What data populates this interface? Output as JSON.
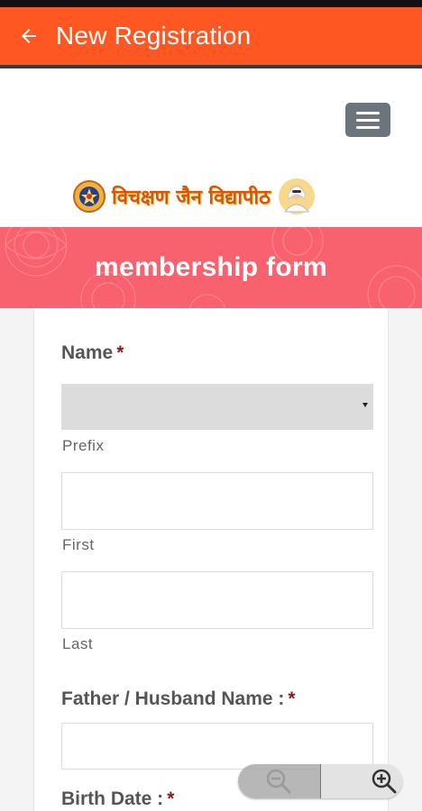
{
  "app_bar": {
    "title": "New Registration",
    "back_icon": "arrow-left-icon",
    "background": "#ff5722"
  },
  "nav": {
    "menu_icon": "hamburger-menu-icon"
  },
  "logo": {
    "text": "विचक्षण जैन विद्यापीठ",
    "emblem_icon": "emblem-icon",
    "portrait_icon": "portrait-icon"
  },
  "banner": {
    "title": "membership form",
    "background": "#f8626f"
  },
  "form": {
    "name": {
      "label": "Name",
      "required_mark": "*",
      "prefix": {
        "value": "",
        "sub_label": "Prefix"
      },
      "first": {
        "value": "",
        "sub_label": "First"
      },
      "last": {
        "value": "",
        "sub_label": "Last"
      }
    },
    "father_husband": {
      "label": "Father / Husband Name :",
      "required_mark": "*",
      "value": ""
    },
    "birth_date": {
      "label": "Birth Date :",
      "required_mark": "*"
    }
  },
  "zoom_control": {
    "zoom_out_icon": "zoom-out-icon",
    "zoom_in_icon": "zoom-in-icon"
  }
}
